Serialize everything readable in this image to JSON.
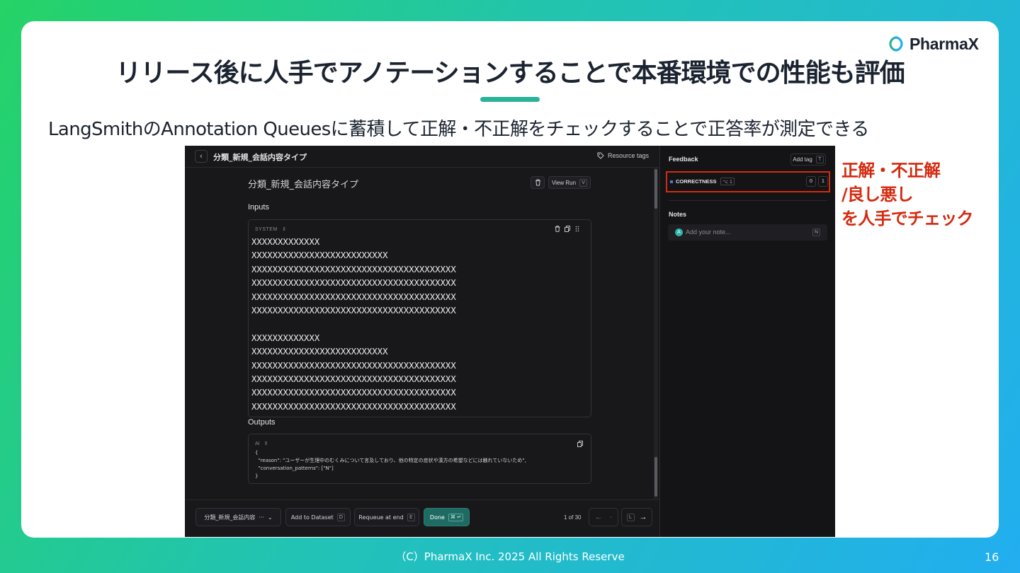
{
  "slide": {
    "title": "リリース後に人手でアノテーションすることで本番環境での性能も評価",
    "subtitle": "LangSmithのAnnotation Queuesに蓄積して正解・不正解をチェックすることで正答率が測定できる",
    "annotation_lines": [
      "正解・不正解",
      "/良し悪し",
      "を人手でチェック"
    ],
    "logo_text": "PharmaX",
    "footer": "（C）PharmaX Inc. 2025  All Rights Reserve",
    "page_number": "16"
  },
  "app": {
    "back_icon": "chevron-left-icon",
    "queue_title": "分類_新規_会話内容タイプ",
    "resource_tags_label": "Resource tags",
    "run_name": "分類_新規_会話内容タイプ",
    "view_run_label": "View Run",
    "view_run_key": "V",
    "inputs_label": "Inputs",
    "system_label": "SYSTEM",
    "input_lines": [
      "XXXXXXXXXXXXX",
      "XXXXXXXXXXXXXXXXXXXXXXXXXX",
      "XXXXXXXXXXXXXXXXXXXXXXXXXXXXXXXXXXXXXXX",
      "XXXXXXXXXXXXXXXXXXXXXXXXXXXXXXXXXXXXXXX",
      "XXXXXXXXXXXXXXXXXXXXXXXXXXXXXXXXXXXXXXX",
      "XXXXXXXXXXXXXXXXXXXXXXXXXXXXXXXXXXXXXXX",
      "",
      "XXXXXXXXXXXXX",
      "XXXXXXXXXXXXXXXXXXXXXXXXXX",
      "XXXXXXXXXXXXXXXXXXXXXXXXXXXXXXXXXXXXXXX",
      "XXXXXXXXXXXXXXXXXXXXXXXXXXXXXXXXXXXXXXX",
      "XXXXXXXXXXXXXXXXXXXXXXXXXXXXXXXXXXXXXXX",
      "XXXXXXXXXXXXXXXXXXXXXXXXXXXXXXXXXXXXXXX"
    ],
    "outputs_label": "Outputs",
    "ai_label": "AI",
    "output_lines": [
      "{",
      "  \"reason\": \"ユーザーが生理中のむくみについて言及しており、他の特定の症状や漢方の希望などには触れていないため\",",
      "  \"conversation_patterns\": [\"N\"]",
      "}"
    ],
    "bottom": {
      "queue_select": "分類_新規_会話内容",
      "add_dataset_label": "Add to Dataset",
      "add_dataset_key": "D",
      "requeue_label": "Requeue at end",
      "requeue_key": "E",
      "done_label": "Done",
      "done_key": "⌘ ↵",
      "page_count": "1 of 30",
      "list_key": "L"
    },
    "feedback": {
      "title": "Feedback",
      "add_tag_label": "Add tag",
      "add_tag_key": "T",
      "criterion_name": "CORRECTNESS",
      "criterion_key": "⌥ 1",
      "score_0": "0",
      "score_1": "1",
      "notes_title": "Notes",
      "note_avatar": "A",
      "note_placeholder": "Add your note...",
      "note_key": "N"
    }
  },
  "colors": {
    "accent_red": "#d42a10",
    "brand_teal": "#2bb39a",
    "done_button": "#1f6b63"
  }
}
